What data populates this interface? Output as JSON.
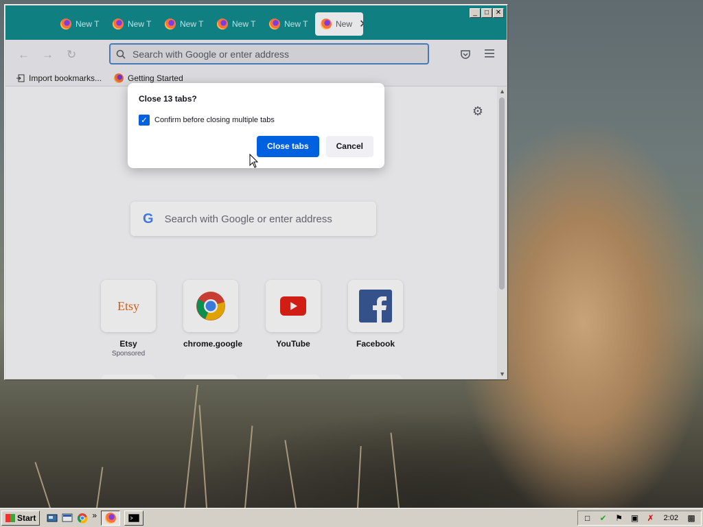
{
  "browser": {
    "tabs": [
      {
        "label": "New T"
      },
      {
        "label": "New T"
      },
      {
        "label": "New T"
      },
      {
        "label": "New T"
      },
      {
        "label": "New T"
      },
      {
        "label": "New"
      }
    ],
    "tab_close": "✕",
    "window_buttons": {
      "minimize": "_",
      "maximize": "□",
      "close": "✕"
    },
    "url_placeholder": "Search with Google or enter address",
    "bookmarks": [
      {
        "label": "Import bookmarks..."
      },
      {
        "label": "Getting Started"
      }
    ],
    "newtab": {
      "search_placeholder": "Search with Google or enter address",
      "google_logo": "G",
      "tiles": [
        {
          "label": "Etsy",
          "sublabel": "Sponsored",
          "logo_text": "Etsy"
        },
        {
          "label": "chrome.google",
          "sublabel": ""
        },
        {
          "label": "YouTube",
          "sublabel": ""
        },
        {
          "label": "Facebook",
          "sublabel": ""
        }
      ]
    },
    "dialog": {
      "title": "Close 13 tabs?",
      "checkbox_label": "Confirm before closing multiple tabs",
      "checkbox_checked": true,
      "checkmark": "✓",
      "primary_button": "Close tabs",
      "secondary_button": "Cancel"
    }
  },
  "taskbar": {
    "start_label": "Start",
    "chevron": "»",
    "clock": "2:02"
  }
}
